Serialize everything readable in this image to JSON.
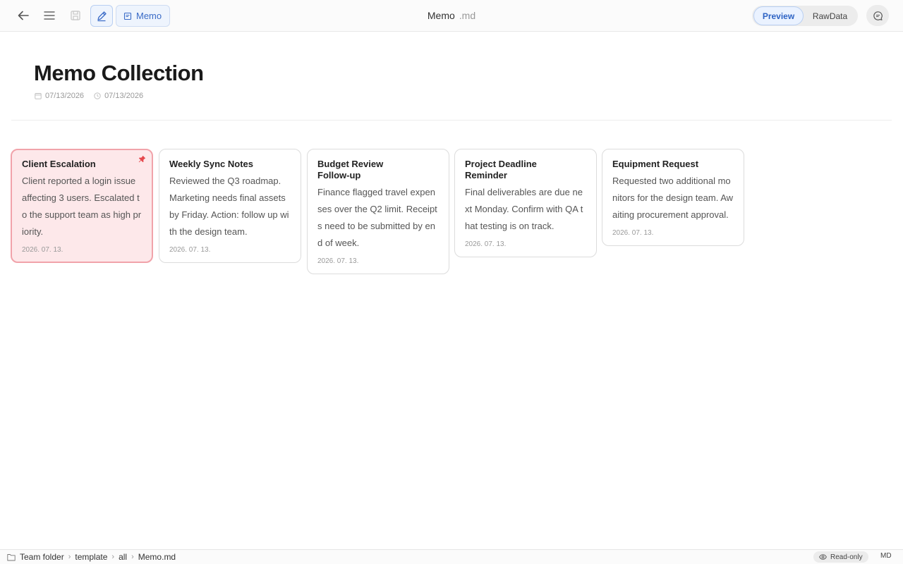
{
  "header": {
    "memo_tab_label": "Memo",
    "doc_name": "Memo",
    "doc_ext": ".md",
    "preview_label": "Preview",
    "rawdata_label": "RawData"
  },
  "page": {
    "title": "Memo Collection",
    "created": "07/13/2026",
    "modified": "07/13/2026"
  },
  "cards": [
    {
      "title": "Client Escalation",
      "body": "Client reported a login issue affecting 3 users. Escalated to the support team as high priority.",
      "date": "2026. 07. 13.",
      "pinned": true
    },
    {
      "title": "Weekly Sync Notes",
      "body": "Reviewed the Q3 roadmap. Marketing needs final assets by Friday. Action: follow up with the design team.",
      "date": "2026. 07. 13.",
      "pinned": false
    },
    {
      "title": "Budget Review\nFollow-up",
      "body": "Finance flagged travel expenses over the Q2 limit. Receipts need to be submitted by end of week.",
      "date": "2026. 07. 13.",
      "pinned": false
    },
    {
      "title": "Project Deadline\nReminder",
      "body": "Final deliverables are due next Monday. Confirm with QA that testing is on track.",
      "date": "2026. 07. 13.",
      "pinned": false
    },
    {
      "title": "Equipment Request",
      "body": "Requested two additional monitors for the design team. Awaiting procurement approval.",
      "date": "2026. 07. 13.",
      "pinned": false
    }
  ],
  "statusbar": {
    "crumbs": [
      "Team folder",
      "template",
      "all",
      "Memo.md"
    ],
    "readonly_label": "Read-only",
    "format_label": "MD"
  },
  "colors": {
    "accent": "#2d63c4",
    "pinned_bg": "#fde8ea",
    "pinned_border": "#f1a3aa",
    "pin_icon": "#e5484d"
  }
}
